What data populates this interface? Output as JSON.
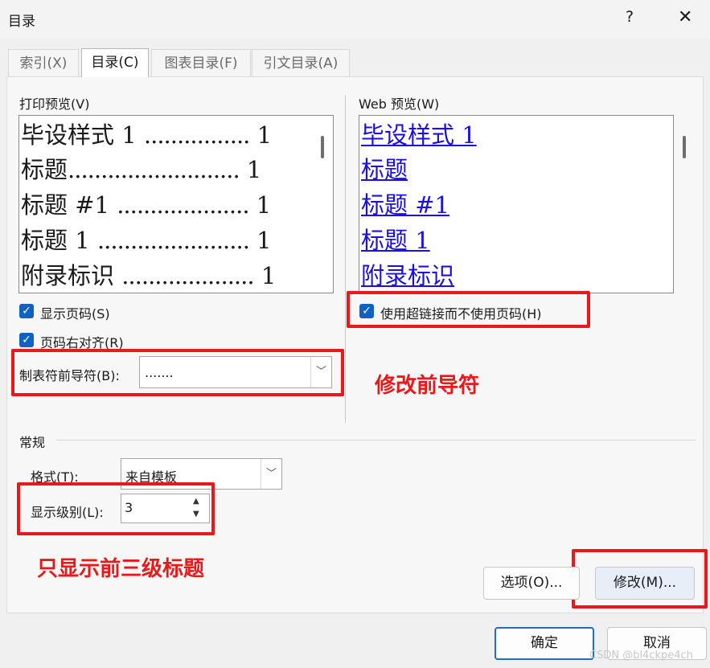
{
  "window": {
    "title": "目录",
    "help_glyph": "?",
    "close_glyph": "✕"
  },
  "tabs": [
    {
      "label": "索引(X)",
      "active": false
    },
    {
      "label": "目录(C)",
      "active": true
    },
    {
      "label": "图表目录(F)",
      "active": false
    },
    {
      "label": "引文目录(A)",
      "active": false
    }
  ],
  "print_preview": {
    "label": "打印预览(V)",
    "rows": [
      {
        "text": "毕设样式 1 ",
        "dots": "................",
        "page": "1"
      },
      {
        "text": "标题",
        "dots": "..........................",
        "page": "1"
      },
      {
        "text": "标题  #1 ",
        "dots": "....................",
        "page": "1"
      },
      {
        "text": "标题  1 ",
        "dots": ".......................",
        "page": "1"
      },
      {
        "text": "附录标识 ",
        "dots": "....................",
        "page": "1"
      }
    ]
  },
  "web_preview": {
    "label": "Web 预览(W)",
    "rows": [
      "毕设样式 1",
      "标题",
      "标题  #1",
      "标题  1",
      "附录标识"
    ]
  },
  "options": {
    "show_page_numbers": {
      "label": "显示页码(S)",
      "checked": true
    },
    "right_align": {
      "label": "页码右对齐(R)",
      "checked": true
    },
    "use_hyperlinks": {
      "label": "使用超链接而不使用页码(H)",
      "checked": true
    },
    "tab_leader": {
      "label": "制表符前导符(B):",
      "value": "......."
    }
  },
  "general": {
    "section_label": "常规",
    "format": {
      "label": "格式(T):",
      "value": "来自模板"
    },
    "levels": {
      "label": "显示级别(L):",
      "value": "3"
    }
  },
  "annotations": {
    "leader": "修改前导符",
    "levels": "只显示前三级标题"
  },
  "buttons": {
    "options": "选项(O)...",
    "modify": "修改(M)...",
    "ok": "确定",
    "cancel": "取消"
  },
  "watermark": "CSDN @bl4ckpe4ch",
  "colors": {
    "accent": "#0f62c4",
    "annotation_red": "#e8191b",
    "link_blue": "#1a10e0"
  }
}
